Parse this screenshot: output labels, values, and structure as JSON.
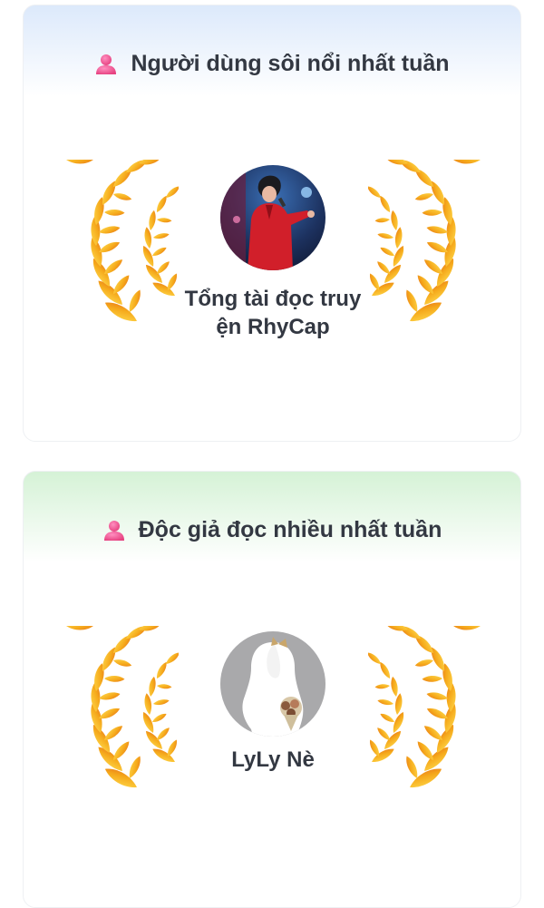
{
  "cards": [
    {
      "title": "Người dùng sôi nổi nhất tuần",
      "icon": "user-icon",
      "user_name": "Tổng tài đọc truyện RhyCap",
      "accent": "#dce9fb"
    },
    {
      "title": "Độc giả đọc nhiều nhất tuần",
      "icon": "user-icon",
      "user_name": "LyLy Nè",
      "accent": "#d5f2d6"
    }
  ],
  "colors": {
    "icon_pink": "#f0559a",
    "laurel_gold": "#f5b41c",
    "laurel_orange": "#ef7e1a"
  }
}
